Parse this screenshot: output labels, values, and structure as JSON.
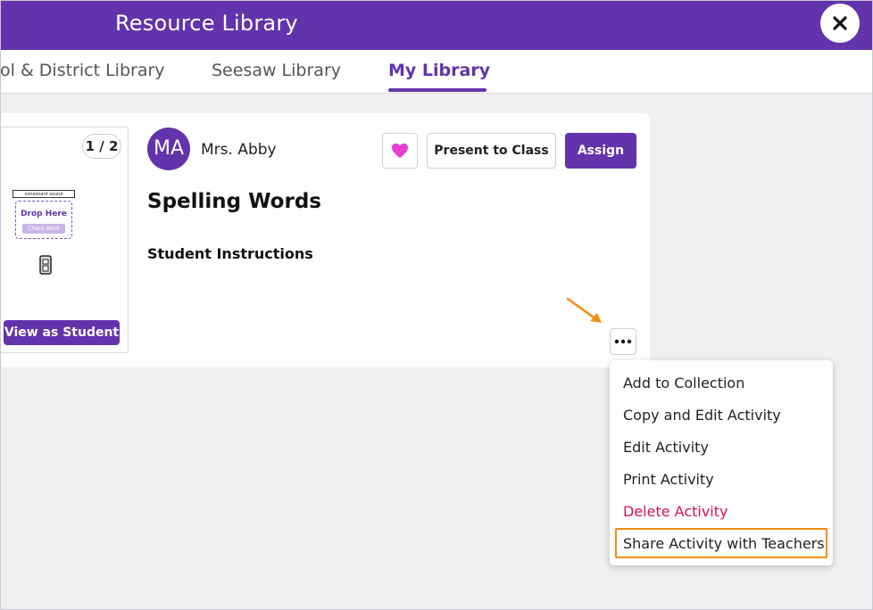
{
  "header": {
    "title": "Resource Library",
    "close_icon": "close-icon"
  },
  "tabs": [
    {
      "label": "ol & District Library",
      "active": false
    },
    {
      "label": "Seesaw Library",
      "active": false
    },
    {
      "label": "My Library",
      "active": true
    }
  ],
  "preview": {
    "page_indicator": "1 / 2",
    "thumbnail": {
      "label_text": "consonant sound",
      "drop_text": "Drop Here",
      "check_text": "Check Work"
    },
    "view_button_label": "View as Student"
  },
  "activity": {
    "avatar_initials": "MA",
    "author": "Mrs. Abby",
    "present_label": "Present to Class",
    "assign_label": "Assign",
    "title": "Spelling Words",
    "instructions_label": "Student Instructions"
  },
  "menu": {
    "items": [
      {
        "label": "Add to Collection"
      },
      {
        "label": "Copy and Edit Activity"
      },
      {
        "label": "Edit Activity"
      },
      {
        "label": "Print Activity"
      },
      {
        "label": "Delete Activity"
      },
      {
        "label": "Share Activity with Teachers"
      }
    ]
  },
  "colors": {
    "brand_purple": "#6333ab",
    "heart_pink": "#e83fd0",
    "danger": "#d6144f",
    "highlight_orange": "#f28c0f"
  }
}
